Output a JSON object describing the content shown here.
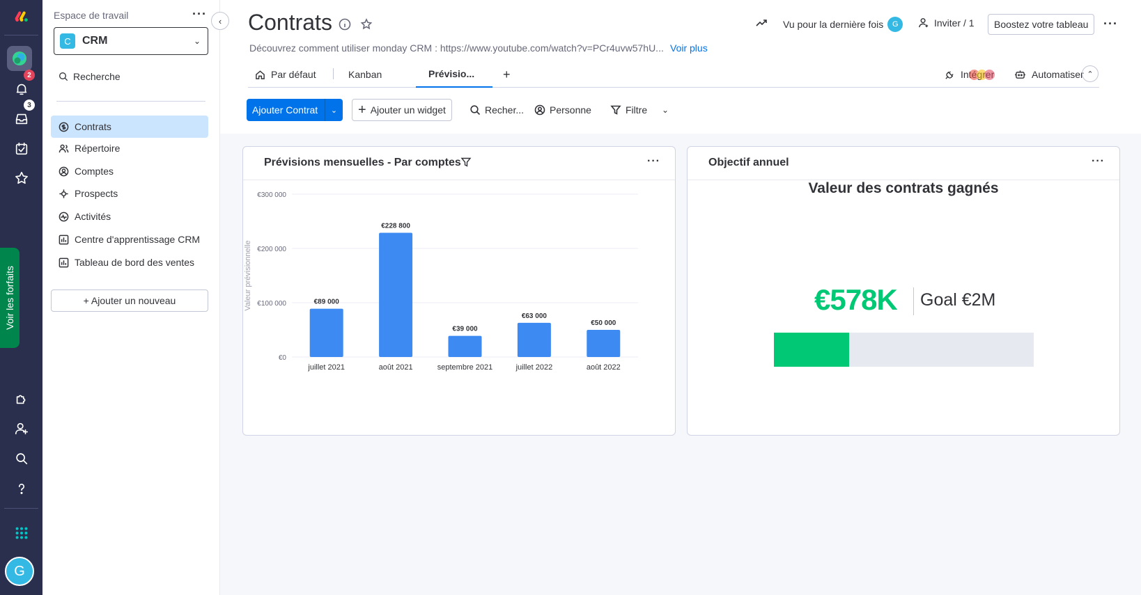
{
  "sidebar": {
    "workspace_label": "Espace de travail",
    "workspace_letter": "C",
    "workspace_name": "CRM",
    "search_label": "Recherche",
    "items": [
      {
        "label": "Contrats",
        "icon": "dollar-circle-icon"
      },
      {
        "label": "Répertoire",
        "icon": "contacts-icon"
      },
      {
        "label": "Comptes",
        "icon": "accounts-icon"
      },
      {
        "label": "Prospects",
        "icon": "leads-icon"
      },
      {
        "label": "Activités",
        "icon": "activity-icon"
      },
      {
        "label": "Centre d'apprentissage CRM",
        "icon": "dashboard-icon"
      },
      {
        "label": "Tableau de bord des ventes",
        "icon": "dashboard-icon"
      }
    ],
    "add_new_label": "+ Ajouter un nouveau"
  },
  "rail": {
    "notifications_count": "2",
    "inbox_count": "3",
    "plans_label": "Voir les forfaits",
    "user_initial": "G"
  },
  "header": {
    "title": "Contrats",
    "description": "Découvrez comment utiliser monday CRM : https://www.youtube.com/watch?v=PCr4uvw57hU...",
    "see_more": "Voir plus",
    "last_seen": "Vu pour la dernière fois",
    "last_seen_initial": "G",
    "invite": "Inviter / 1",
    "boost": "Boostez votre tableau"
  },
  "tabs": [
    {
      "label": "Par défaut"
    },
    {
      "label": "Kanban"
    },
    {
      "label": "Prévisio..."
    }
  ],
  "tab_add": "+",
  "tabs_right": {
    "integrate": "Intégrer",
    "automate": "Automatiser"
  },
  "toolbar": {
    "add_contract": "Ajouter Contrat",
    "add_widget": "Ajouter un widget",
    "search": "Recher...",
    "person": "Personne",
    "filter": "Filtre"
  },
  "widget_forecast": {
    "title": "Prévisions mensuelles - Par comptes"
  },
  "widget_goal": {
    "title": "Objectif annuel",
    "heading": "Valeur des contrats gagnés",
    "value": "€578K",
    "target": "Goal €2M",
    "progress": 0.289
  },
  "colors": {
    "accent": "#0073ea",
    "bar": "#3d8bf2",
    "goal": "#00c875"
  },
  "chart_data": {
    "type": "bar",
    "title": "",
    "ylabel": "Valeur prévisionnelle",
    "categories": [
      "juillet 2021",
      "août 2021",
      "septembre 2021",
      "juillet 2022",
      "août 2022"
    ],
    "values": [
      89000,
      228800,
      39000,
      63000,
      50000
    ],
    "value_labels": [
      "€89 000",
      "€228 800",
      "€39 000",
      "€63 000",
      "€50 000"
    ],
    "ylim": [
      0,
      300000
    ],
    "yticks": [
      0,
      100000,
      200000,
      300000
    ],
    "ytick_labels": [
      "€0",
      "€100 000",
      "€200 000",
      "€300 000"
    ],
    "grid": true
  }
}
